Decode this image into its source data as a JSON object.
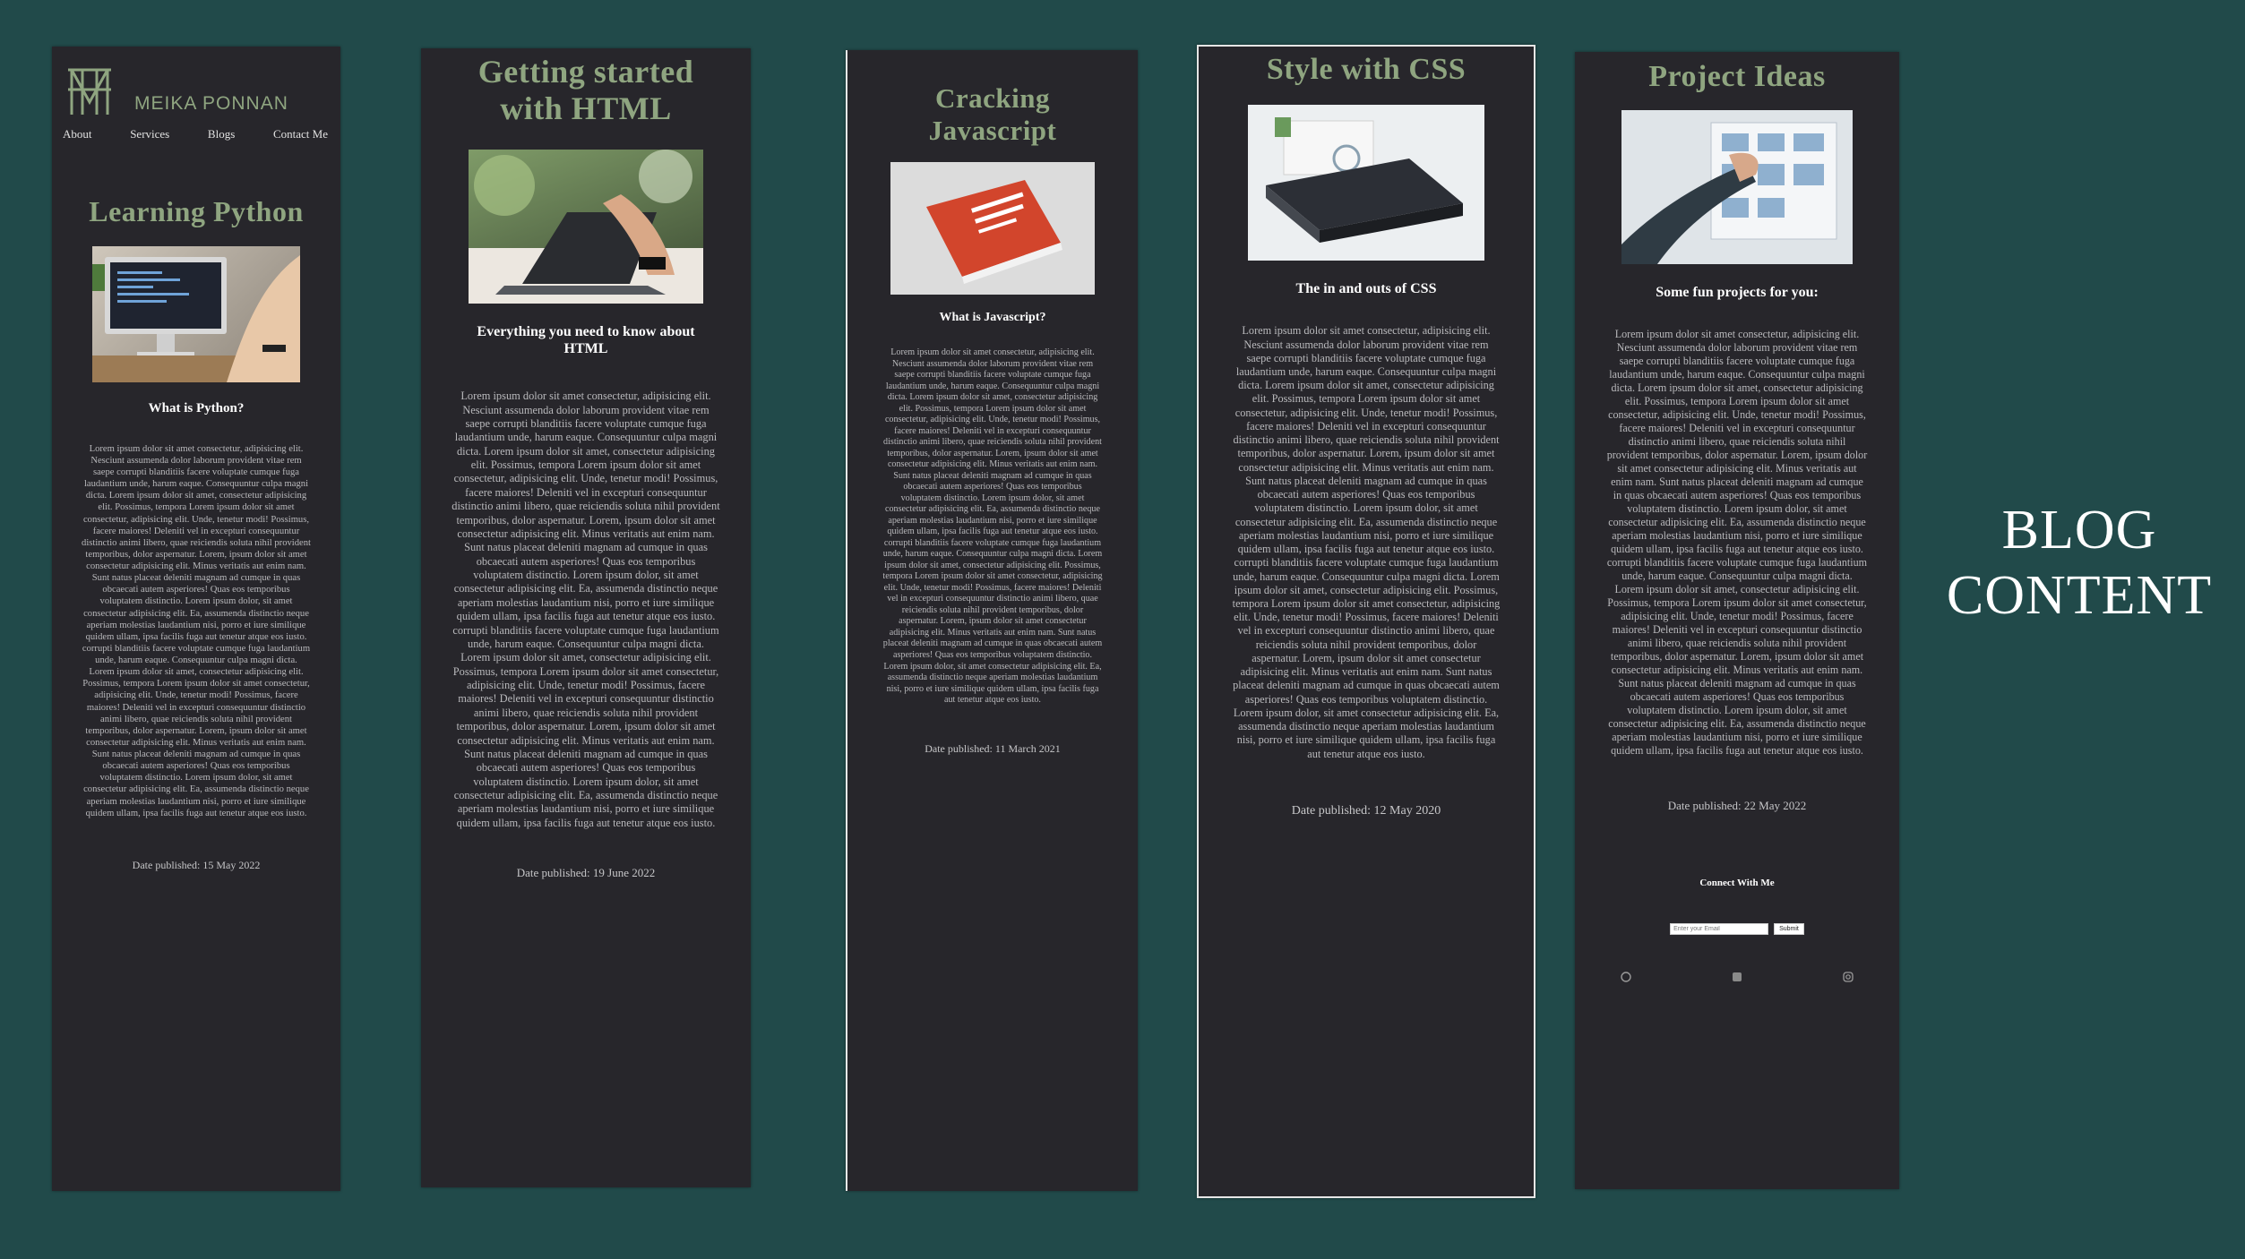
{
  "theme": {
    "background": "#214a4a",
    "card": "#27262b",
    "accent": "#8fa580"
  },
  "side_heading": "BLOG\nCONTENT",
  "body_text": "Lorem ipsum dolor sit amet consectetur, adipisicing elit. Nesciunt assumenda dolor laborum provident vitae rem saepe corrupti blanditiis facere voluptate cumque fuga laudantium unde, harum eaque. Consequuntur culpa magni dicta. Lorem ipsum dolor sit amet, consectetur adipisicing elit. Possimus, tempora Lorem ipsum dolor sit amet consectetur, adipisicing elit. Unde, tenetur modi! Possimus, facere maiores! Deleniti vel in excepturi consequuntur distinctio animi libero, quae reiciendis soluta nihil provident temporibus, dolor aspernatur. Lorem, ipsum dolor sit amet consectetur adipisicing elit. Minus veritatis aut enim nam. Sunt natus placeat deleniti magnam ad cumque in quas obcaecati autem asperiores! Quas eos temporibus voluptatem distinctio. Lorem ipsum dolor, sit amet consectetur adipisicing elit. Ea, assumenda distinctio neque aperiam molestias laudantium nisi, porro et iure similique quidem ullam, ipsa facilis fuga aut tenetur atque eos iusto. corrupti blanditiis facere voluptate cumque fuga laudantium unde, harum eaque. Consequuntur culpa magni dicta. Lorem ipsum dolor sit amet, consectetur adipisicing elit. Possimus, tempora Lorem ipsum dolor sit amet consectetur, adipisicing elit. Unde, tenetur modi! Possimus, facere maiores! Deleniti vel in excepturi consequuntur distinctio animi libero, quae reiciendis soluta nihil provident temporibus, dolor aspernatur. Lorem, ipsum dolor sit amet consectetur adipisicing elit. Minus veritatis aut enim nam. Sunt natus placeat deleniti magnam ad cumque in quas obcaecati autem asperiores! Quas eos temporibus voluptatem distinctio. Lorem ipsum dolor, sit amet consectetur adipisicing elit. Ea, assumenda distinctio neque aperiam molestias laudantium nisi, porro et iure similique quidem ullam, ipsa facilis fuga aut tenetur atque eos iusto.",
  "site": {
    "brand": "MEIKA PONNAN",
    "nav": [
      "About",
      "Services",
      "Blogs",
      "Contact Me"
    ]
  },
  "cards": [
    {
      "title": "Learning Python",
      "subtitle": "What is Python?",
      "date": "Date published: 15 May 2022",
      "image": "computer-desk-photo"
    },
    {
      "title": "Getting started\nwith HTML",
      "subtitle": "Everything you need to know about\nHTML",
      "date": "Date published: 19 June 2022",
      "image": "laptop-typing-photo"
    },
    {
      "title": "Cracking\nJavascript",
      "subtitle": "What is Javascript?",
      "date": "Date published: 11 March 2021",
      "image": "javascript-book-photo"
    },
    {
      "title": "Style with CSS",
      "subtitle": "The in and outs of CSS",
      "date": "Date published: 12 May 2020",
      "image": "css-books-photo"
    },
    {
      "title": "Project Ideas",
      "subtitle": "Some fun projects for you:",
      "date": "Date published: 22 May 2022",
      "image": "project-board-photo"
    }
  ],
  "connect": {
    "heading": "Connect With Me",
    "email_placeholder": "Enter your Email",
    "submit_label": "Submit",
    "social_icons": [
      "github-icon",
      "linkedin-icon",
      "instagram-icon"
    ]
  }
}
